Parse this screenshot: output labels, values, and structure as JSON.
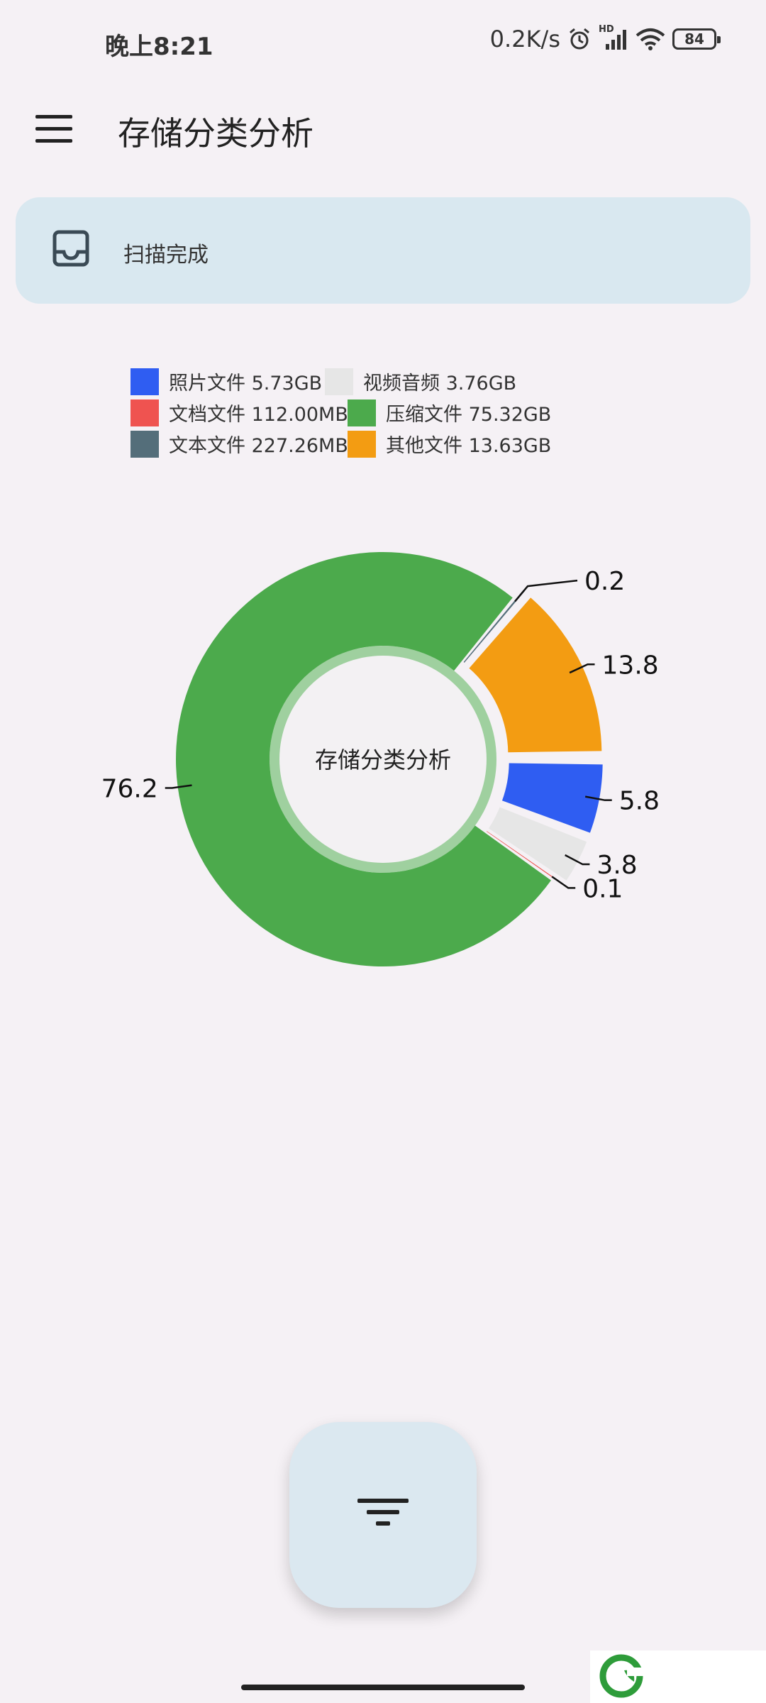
{
  "status_bar": {
    "time": "晚上8:21",
    "network_speed": "0.2K/s",
    "signal_badge": "HD",
    "battery": "84"
  },
  "app_bar": {
    "title": "存储分类分析",
    "menu_icon": "menu-icon"
  },
  "scan_status": {
    "icon": "tray-icon",
    "text": "扫描完成"
  },
  "legend": [
    {
      "label": "照片文件 5.73GB",
      "color": "#2f5df2"
    },
    {
      "label": "视频音频 3.76GB",
      "color": "#e6e6e6"
    },
    {
      "label": "文档文件 112.00MB",
      "color": "#ef5350"
    },
    {
      "label": "压缩文件 75.32GB",
      "color": "#4caa4c"
    },
    {
      "label": "文本文件 227.26MB",
      "color": "#546e7a"
    },
    {
      "label": "其他文件 13.63GB",
      "color": "#f39c12"
    }
  ],
  "chart_data": {
    "type": "pie",
    "title": "存储分类分析",
    "categories": [
      "照片文件",
      "视频音频",
      "文档文件",
      "压缩文件",
      "文本文件",
      "其他文件"
    ],
    "values": [
      5.8,
      3.8,
      0.1,
      76.2,
      0.2,
      13.8
    ],
    "colors": [
      "#2f5df2",
      "#e6e6e6",
      "#ef5350",
      "#4caa4c",
      "#546e7a",
      "#f39c12"
    ],
    "data_labels": [
      "5.8",
      "3.8",
      "0.1",
      "76.2",
      "0.2",
      "13.8"
    ]
  },
  "fab": {
    "icon": "filter-icon"
  },
  "watermark": {
    "icon": "logo-icon"
  }
}
